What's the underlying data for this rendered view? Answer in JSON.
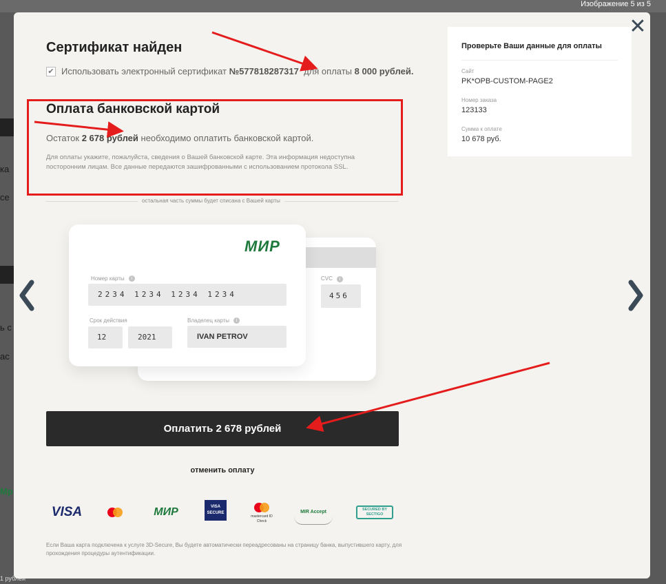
{
  "background": {
    "image_counter": "Изображение 5 из 5",
    "fragments": [
      "ка",
      "се",
      "ь с",
      "ас",
      "Мр",
      "1 рублей"
    ]
  },
  "certificate": {
    "title": "Сертификат найден",
    "checkbox_checked": true,
    "text_use": "Использовать электронный сертификат",
    "cert_number": "№577818287317",
    "text_for": "для оплаты",
    "amount": "8 000 рублей."
  },
  "card_payment": {
    "title": "Оплата банковской картой",
    "remain_prefix": "Остаток",
    "remain_amount": "2 678 рублей",
    "remain_suffix": "необходимо оплатить банковской картой.",
    "note": "Для оплаты укажите, пожалуйста, сведения о Вашей банковской карте. Эта информация недоступна посторонним лицам. Все данные передаются зашифрованными с использованием протокола SSL.",
    "divider_text": "остальная часть суммы будет списана с Вашей карты"
  },
  "card": {
    "brand": "МИР",
    "number_label": "Номер карты",
    "number": "2234 1234 1234 1234",
    "expiry_label": "Срок действия",
    "month": "12",
    "year": "2021",
    "holder_label": "Владелец карты",
    "holder": "IVAN PETROV",
    "cvc_label": "CVC",
    "cvc": "456"
  },
  "actions": {
    "pay_label": "Оплатить 2 678 рублей",
    "cancel_label": "отменить оплату"
  },
  "payment_logos": [
    "VISA",
    "mastercard",
    "МИР",
    "VISA SECURE",
    "mastercard ID Check",
    "MIR Accept",
    "SECURED BY SECTIGO"
  ],
  "footer_note": "Если Ваша карта подключена к услуге 3D-Secure, Вы будете автоматически переадресованы на страницу банка, выпустившего карту, для прохождения процедуры аутентификации.",
  "summary": {
    "title": "Проверьте Ваши данные для оплаты",
    "site_label": "Сайт",
    "site_value": "PK*OPB-CUSTOM-PAGE2",
    "order_label": "Номер заказа",
    "order_value": "123133",
    "sum_label": "Сумма к оплате",
    "sum_value": "10 678 руб."
  },
  "colors": {
    "annotation_red": "#e41c1c",
    "button_dark": "#2a2a2a",
    "mir_green": "#1e7a3c"
  }
}
